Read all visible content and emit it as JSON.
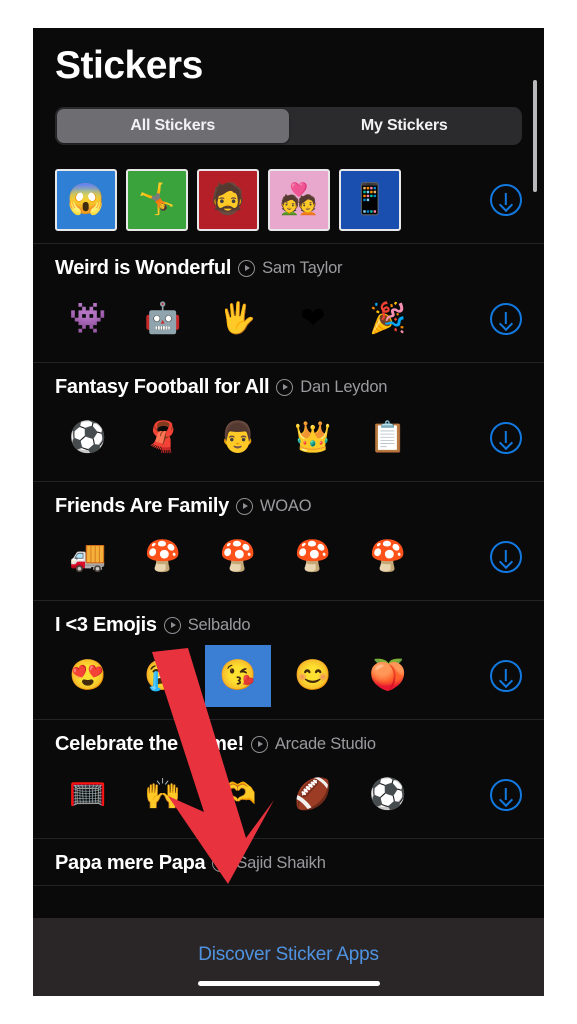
{
  "header": {
    "title": "Stickers"
  },
  "segmented_control": {
    "options": [
      "All Stickers",
      "My Stickers"
    ],
    "selected": "All Stickers"
  },
  "packs": [
    {
      "title": "",
      "author": "",
      "has_header": false,
      "framed": true,
      "download_label": "download",
      "stickers": [
        {
          "name": "sticker-mask-face",
          "glyph": "😱",
          "bg": "#2f7fd4"
        },
        {
          "name": "sticker-red-suit-jump",
          "glyph": "🤸",
          "bg": "#3ba33b"
        },
        {
          "name": "sticker-bearded-man",
          "glyph": "🧔",
          "bg": "#b51f28"
        },
        {
          "name": "sticker-couple",
          "glyph": "💑",
          "bg": "#e8a8cd"
        },
        {
          "name": "sticker-red-suit-phone",
          "glyph": "📱",
          "bg": "#1a4fb0"
        }
      ]
    },
    {
      "title": "Weird is Wonderful",
      "author": "Sam Taylor",
      "has_header": true,
      "framed": false,
      "download_label": "download",
      "stickers": [
        {
          "name": "sticker-blob-creature",
          "glyph": "👾",
          "bg": "transparent"
        },
        {
          "name": "sticker-robot",
          "glyph": "🤖",
          "bg": "transparent"
        },
        {
          "name": "sticker-hand-wave",
          "glyph": "🖐",
          "bg": "transparent"
        },
        {
          "name": "sticker-confetti-heart",
          "glyph": "❤",
          "bg": "transparent"
        },
        {
          "name": "sticker-party-creature",
          "glyph": "🎉",
          "bg": "transparent"
        }
      ]
    },
    {
      "title": "Fantasy Football for All",
      "author": "Dan Leydon",
      "has_header": true,
      "framed": false,
      "download_label": "download",
      "stickers": [
        {
          "name": "sticker-football-heart",
          "glyph": "⚽",
          "bg": "transparent"
        },
        {
          "name": "sticker-fan-scarf",
          "glyph": "🧣",
          "bg": "transparent"
        },
        {
          "name": "sticker-player-blue",
          "glyph": "👨",
          "bg": "transparent"
        },
        {
          "name": "sticker-crowned-player",
          "glyph": "👑",
          "bg": "transparent"
        },
        {
          "name": "sticker-fan-sign",
          "glyph": "📋",
          "bg": "transparent"
        }
      ]
    },
    {
      "title": "Friends Are Family",
      "author": "WOAO",
      "has_header": true,
      "framed": false,
      "download_label": "download",
      "stickers": [
        {
          "name": "sticker-truck-cab",
          "glyph": "🚚",
          "bg": "transparent"
        },
        {
          "name": "sticker-mushroom-pair",
          "glyph": "🍄",
          "bg": "transparent"
        },
        {
          "name": "sticker-mushroom-group",
          "glyph": "🍄",
          "bg": "transparent"
        },
        {
          "name": "sticker-mushroom-angry",
          "glyph": "🍄",
          "bg": "transparent"
        },
        {
          "name": "sticker-mushroom-hug",
          "glyph": "🍄",
          "bg": "transparent"
        }
      ]
    },
    {
      "title": "I <3 Emojis",
      "author": "Selbaldo",
      "has_header": true,
      "framed": false,
      "download_label": "download",
      "stickers": [
        {
          "name": "sticker-heart-eyes-cloud",
          "glyph": "😍",
          "bg": "transparent"
        },
        {
          "name": "sticker-crying-emoji",
          "glyph": "😭",
          "bg": "transparent"
        },
        {
          "name": "sticker-kissing-emoji",
          "glyph": "😘",
          "bg": "#3b7fd4"
        },
        {
          "name": "sticker-smiling-emoji",
          "glyph": "😊",
          "bg": "transparent"
        },
        {
          "name": "sticker-eggplant-peach",
          "glyph": "🍑",
          "bg": "transparent"
        }
      ]
    },
    {
      "title": "Celebrate the Game!",
      "author": "Arcade Studio",
      "has_header": true,
      "framed": false,
      "download_label": "download",
      "stickers": [
        {
          "name": "sticker-goalpost",
          "glyph": "🥅",
          "bg": "transparent"
        },
        {
          "name": "sticker-fan-cheering",
          "glyph": "🙌",
          "bg": "transparent"
        },
        {
          "name": "sticker-heart-hands",
          "glyph": "🫶",
          "bg": "transparent"
        },
        {
          "name": "sticker-player-purple",
          "glyph": "🏈",
          "bg": "transparent"
        },
        {
          "name": "sticker-running-ball",
          "glyph": "⚽",
          "bg": "transparent"
        }
      ]
    },
    {
      "title": "Papa mere Papa",
      "author": "Sajid Shaikh",
      "has_header": true,
      "framed": false,
      "partial": true,
      "download_label": "download",
      "stickers": []
    }
  ],
  "bottom": {
    "discover_label": "Discover Sticker Apps"
  },
  "colors": {
    "accent_blue": "#1279e0",
    "link_blue": "#4f93e0",
    "background": "#0a0a0a",
    "annotation_red": "#e8333f"
  }
}
